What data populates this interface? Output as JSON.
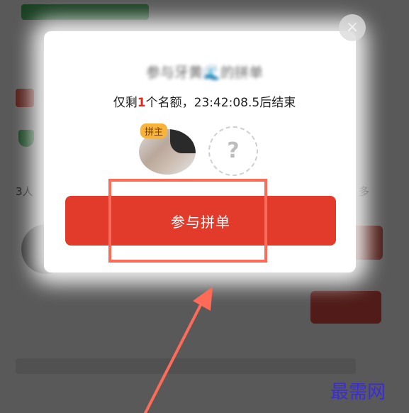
{
  "dialog": {
    "title": "参与牙黄🌊的拼单",
    "subtitle_prefix": "仅剩",
    "subtitle_count": "1",
    "subtitle_suffix": "个名额，23:42:08.5后结束",
    "host_badge": "拼主",
    "empty_slot_symbol": "?",
    "join_button_label": "参与拼单",
    "close_symbol": "×"
  },
  "background": {
    "people_text": "3人",
    "more_text": "多"
  },
  "watermark": "最需网",
  "colors": {
    "accent_red": "#e23a2b",
    "annotation": "#ff6b57",
    "badge": "#f6b43b",
    "watermark": "#3b2bd8"
  },
  "icons": [
    "close-icon",
    "question-mark-icon",
    "shield-icon"
  ]
}
